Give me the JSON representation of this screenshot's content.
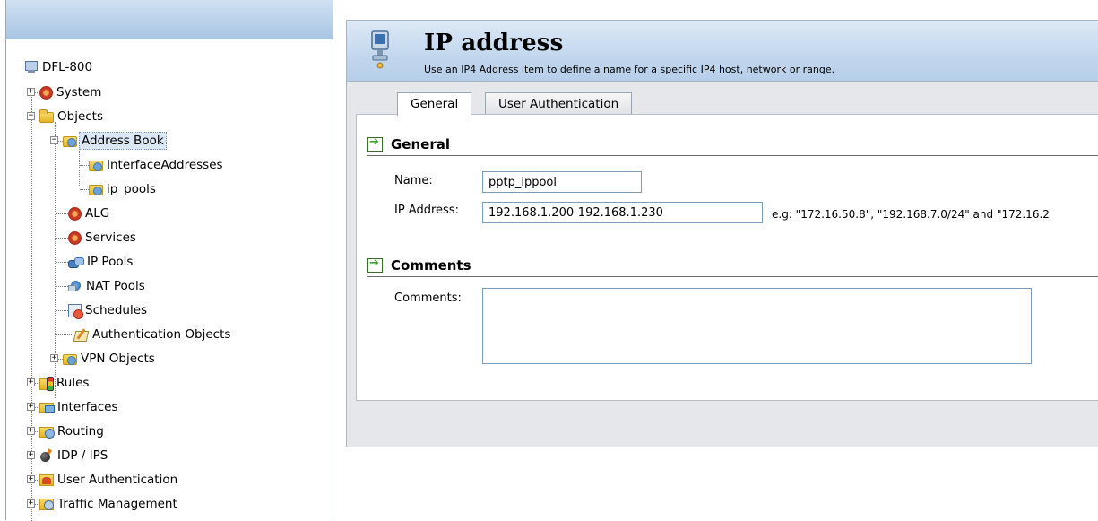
{
  "tree": {
    "items": [
      {
        "label": "DFL-800"
      },
      {
        "label": "System"
      },
      {
        "label": "Objects"
      },
      {
        "label": "Address Book"
      },
      {
        "label": "InterfaceAddresses"
      },
      {
        "label": "ip_pools"
      },
      {
        "label": "ALG"
      },
      {
        "label": "Services"
      },
      {
        "label": "IP Pools"
      },
      {
        "label": "NAT Pools"
      },
      {
        "label": "Schedules"
      },
      {
        "label": "Authentication Objects"
      },
      {
        "label": "VPN Objects"
      },
      {
        "label": "Rules"
      },
      {
        "label": "Interfaces"
      },
      {
        "label": "Routing"
      },
      {
        "label": "IDP / IPS"
      },
      {
        "label": "User Authentication"
      },
      {
        "label": "Traffic Management"
      }
    ],
    "expander_plus": "+",
    "expander_minus": "−"
  },
  "header": {
    "title": "IP address",
    "subtitle": "Use an IP4 Address item to define a name for a specific IP4 host, network or range."
  },
  "tabs": [
    {
      "label": "General"
    },
    {
      "label": "User Authentication"
    }
  ],
  "general": {
    "heading": "General",
    "name_label": "Name:",
    "name_value": "pptp_ippool",
    "ip_label": "IP Address:",
    "ip_value": "192.168.1.200-192.168.1.230",
    "ip_hint": "e.g: \"172.16.50.8\", \"192.168.7.0/24\" and \"172.16.2"
  },
  "comments": {
    "heading": "Comments",
    "label": "Comments:",
    "value": ""
  },
  "colors": {
    "header_gradient": "#c2d7ee",
    "selected_bg": "#dbe7f5",
    "section_arrow": "#3fa12f"
  }
}
